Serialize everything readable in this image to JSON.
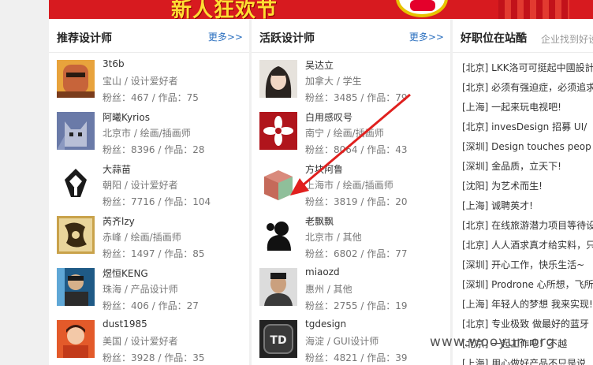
{
  "recommended": {
    "title": "推荐设计师",
    "more": "更多>>",
    "designers": [
      {
        "name": "3t6b",
        "location": "宝山 / 设计爱好者",
        "stats": "粉丝：467 / 作品：75"
      },
      {
        "name": "阿曦Kyrios",
        "location": "北京市 / 绘画/插画师",
        "stats": "粉丝：8396 / 作品：28"
      },
      {
        "name": "大蒜苗",
        "location": "朝阳 / 设计爱好者",
        "stats": "粉丝：7716 / 作品：104"
      },
      {
        "name": "芮齐lzy",
        "location": "赤峰 / 绘画/插画师",
        "stats": "粉丝：1497 / 作品：85"
      },
      {
        "name": "煜恒KENG",
        "location": "珠海 / 产品设计师",
        "stats": "粉丝：406 / 作品：27"
      },
      {
        "name": "dust1985",
        "location": "美国 / 设计爱好者",
        "stats": "粉丝：3928 / 作品：35"
      }
    ]
  },
  "active": {
    "title": "活跃设计师",
    "more": "更多>>",
    "designers": [
      {
        "name": "吴达立",
        "location": "加拿大 / 学生",
        "stats": "粉丝：3485 / 作品：79"
      },
      {
        "name": "白用感叹号",
        "location": "南宁 / 绘画/插画师",
        "stats": "粉丝：8064 / 作品：43"
      },
      {
        "name": "方块阿鲁",
        "location": "上海市 / 绘画/插画师",
        "stats": "粉丝：3819 / 作品：20"
      },
      {
        "name": "老飘飘",
        "location": "北京市 / 其他",
        "stats": "粉丝：6802 / 作品：77"
      },
      {
        "name": "miaozd",
        "location": "惠州 / 其他",
        "stats": "粉丝：2755 / 作品：19"
      },
      {
        "name": "tgdesign",
        "location": "海淀 / GUI设计师",
        "stats": "粉丝：4821 / 作品：39"
      }
    ]
  },
  "jobs": {
    "title": "好职位在站酷",
    "subtitle": "企业找到好设",
    "items": [
      "[北京] LKK洛可可挺起中國設計",
      "[北京] 必须有强迫症，必须追求",
      "[上海] 一起来玩电视吧!",
      "[北京] invesDesign 招募 UI/",
      "[深圳] Design touches peop",
      "[深圳] 金品质，立天下!",
      "[沈阳] 为艺术而生!",
      "[上海] 诚聘英才!",
      "[北京] 在线旅游潜力项目等待设",
      "[北京] 人人酒求真才给实料，只",
      "[深圳] 开心工作，快乐生活~",
      "[深圳] Prodrone 心所想，飞所",
      "[上海] 年轻人的梦想 我来实现!",
      "[北京] 专业极致 做最好的蓝牙",
      "[北京] 一起工作吧！不越",
      "[上海] 用心做好产品不只是说"
    ]
  },
  "banner": {
    "text": "新人狂欢节"
  },
  "watermark": "www.wooyun.org"
}
